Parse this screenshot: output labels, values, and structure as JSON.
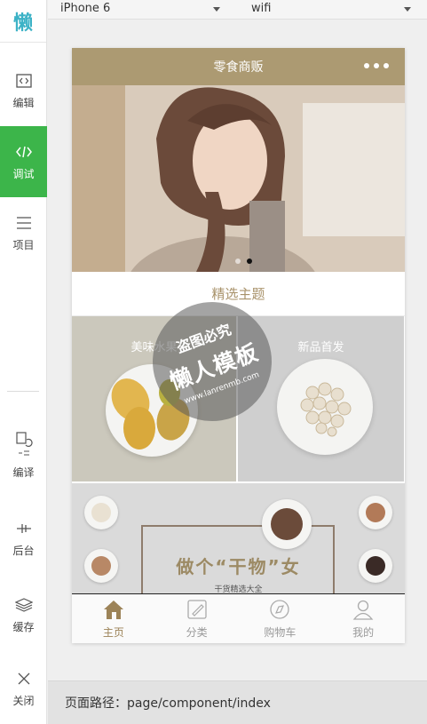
{
  "sidebar": {
    "logo": "懒",
    "tools": [
      {
        "label": "编辑",
        "icon": "code-file-icon"
      },
      {
        "label": "调试",
        "icon": "code-icon"
      },
      {
        "label": "项目",
        "icon": "menu-lines-icon"
      },
      {
        "label": "编译",
        "icon": "compile-icon"
      },
      {
        "label": "后台",
        "icon": "backend-icon"
      },
      {
        "label": "缓存",
        "icon": "layers-icon"
      },
      {
        "label": "关闭",
        "icon": "close-icon"
      }
    ],
    "active_index": 1,
    "accent_color": "#3cb54a"
  },
  "topbar": {
    "device": "iPhone 6",
    "network": "wifi"
  },
  "phone": {
    "nav_title": "零食商贩",
    "nav_color": "#ac9a72",
    "banner": {
      "slides": 2,
      "active_slide": 2
    },
    "section_title": "精选主题",
    "tiles": [
      {
        "label": "美味水果"
      },
      {
        "label": "新品首发"
      }
    ],
    "promo": {
      "headline": "做个“干物”女",
      "subtitle": "干货精选大全"
    },
    "tabs": [
      {
        "label": "主页",
        "icon": "home-icon",
        "active": true
      },
      {
        "label": "分类",
        "icon": "edit-icon",
        "active": false
      },
      {
        "label": "购物车",
        "icon": "compass-icon",
        "active": false
      },
      {
        "label": "我的",
        "icon": "user-icon",
        "active": false
      }
    ]
  },
  "watermark": {
    "line1": "盗图必究",
    "line2": "懒人模板",
    "line3": "www.lanrenmb.com"
  },
  "footer": {
    "path_label": "页面路径：page/component/index"
  }
}
